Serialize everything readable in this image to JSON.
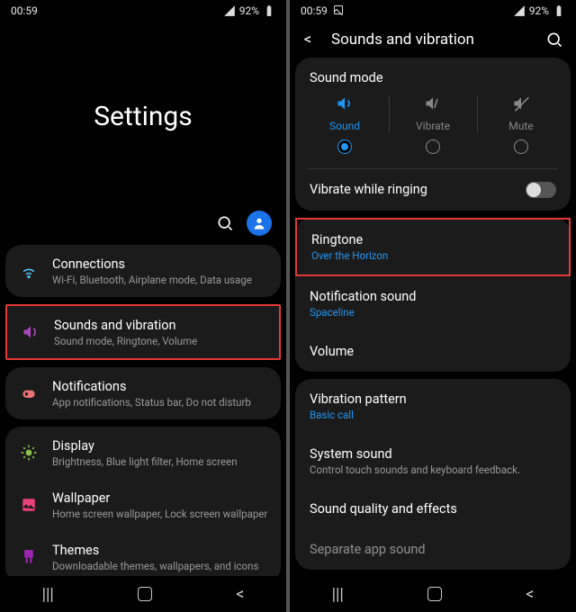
{
  "status": {
    "time": "00:59",
    "battery": "92%"
  },
  "left": {
    "header": "Settings",
    "items": [
      {
        "title": "Connections",
        "sub": "Wi-Fi, Bluetooth, Airplane mode, Data usage"
      },
      {
        "title": "Sounds and vibration",
        "sub": "Sound mode, Ringtone, Volume"
      },
      {
        "title": "Notifications",
        "sub": "App notifications, Status bar, Do not disturb"
      },
      {
        "title": "Display",
        "sub": "Brightness, Blue light filter, Home screen"
      },
      {
        "title": "Wallpaper",
        "sub": "Home screen wallpaper, Lock screen wallpaper"
      },
      {
        "title": "Themes",
        "sub": "Downloadable themes, wallpapers, and icons"
      }
    ]
  },
  "right": {
    "header": "Sounds and vibration",
    "sound_mode": {
      "label": "Sound mode",
      "options": [
        "Sound",
        "Vibrate",
        "Mute"
      ],
      "selected": "Sound"
    },
    "vibrate_ringing": "Vibrate while ringing",
    "rows": [
      {
        "title": "Ringtone",
        "sub": "Over the Horizon",
        "blue": true,
        "hl": true
      },
      {
        "title": "Notification sound",
        "sub": "Spaceline",
        "blue": true
      },
      {
        "title": "Volume"
      },
      {
        "title": "Vibration pattern",
        "sub": "Basic call",
        "blue": true
      },
      {
        "title": "System sound",
        "sub": "Control touch sounds and keyboard feedback.",
        "blue": false
      },
      {
        "title": "Sound quality and effects"
      },
      {
        "title": "Separate app sound"
      }
    ]
  }
}
